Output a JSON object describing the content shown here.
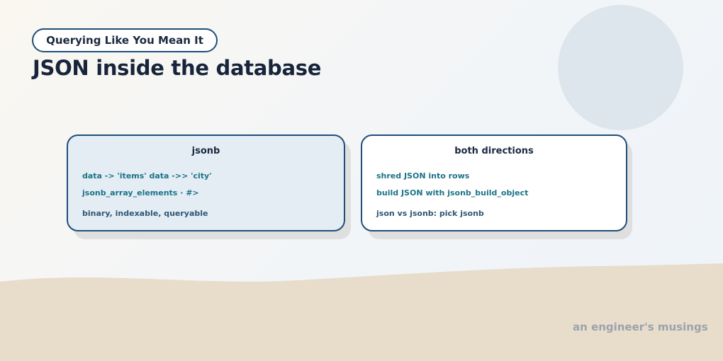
{
  "header": {
    "tag": "Querying Like You Mean It",
    "title": "JSON inside the database"
  },
  "cards": [
    {
      "title": "jsonb",
      "lines": [
        "data -> 'items' data ->> 'city'",
        "jsonb_array_elements · #>",
        "binary, indexable, queryable"
      ]
    },
    {
      "title": "both directions",
      "lines": [
        "shred JSON into rows",
        "build JSON with jsonb_build_object",
        "json vs jsonb: pick jsonb"
      ]
    }
  ],
  "footer": {
    "text": "an engineer's musings"
  },
  "colors": {
    "accent_border": "#1f4e79",
    "code_teal": "#1c7388",
    "text_navy": "#2f5775",
    "sand": "#e8dccb",
    "circle": "#dde6ed"
  }
}
